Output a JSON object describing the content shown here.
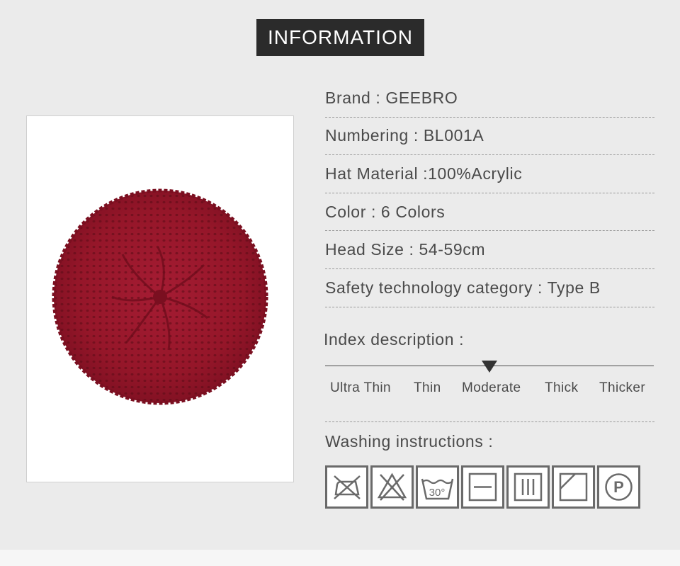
{
  "header": {
    "title": "INFORMATION"
  },
  "photo": {
    "subject": "knitted-beret-burgundy",
    "color": "#9e1b30"
  },
  "info": [
    {
      "text": "Brand : GEEBRO"
    },
    {
      "text": "Numbering : BL001A"
    },
    {
      "text": "Hat Material :100%Acrylic"
    },
    {
      "text": "Color : 6 Colors"
    },
    {
      "text": "Head Size : 54-59cm"
    },
    {
      "text": "Safety technology category : Type B"
    }
  ],
  "index": {
    "title": "Index description :",
    "scale": [
      "Ultra Thin",
      "Thin",
      "Moderate",
      "Thick",
      "Thicker"
    ],
    "selected": "Moderate"
  },
  "washing": {
    "title": "Washing instructions :",
    "icons": [
      {
        "name": "do-not-iron-icon"
      },
      {
        "name": "do-not-bleach-icon"
      },
      {
        "name": "wash-30-icon",
        "label": "30°"
      },
      {
        "name": "dry-flat-icon"
      },
      {
        "name": "drip-dry-icon"
      },
      {
        "name": "dry-in-shade-icon"
      },
      {
        "name": "professional-dry-clean-icon",
        "label": "P"
      }
    ]
  }
}
